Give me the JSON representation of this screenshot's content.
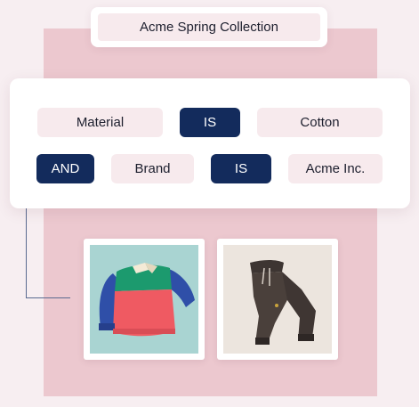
{
  "collection": {
    "title": "Acme Spring Collection"
  },
  "filter": {
    "row1": {
      "field": "Material",
      "operator": "IS",
      "value": "Cotton"
    },
    "row2": {
      "joiner": "AND",
      "field": "Brand",
      "operator": "IS",
      "value": "Acme Inc."
    }
  },
  "products": [
    {
      "icon": "striped-sweater-image",
      "background": "#a9d4d2"
    },
    {
      "icon": "jogger-pants-image",
      "background": "#ece5de"
    }
  ],
  "colors": {
    "accent_dark": "#132b5c",
    "chip_light": "#f7eaed",
    "backdrop_pink": "#ecc8cf",
    "page_background": "#f7eef1"
  }
}
